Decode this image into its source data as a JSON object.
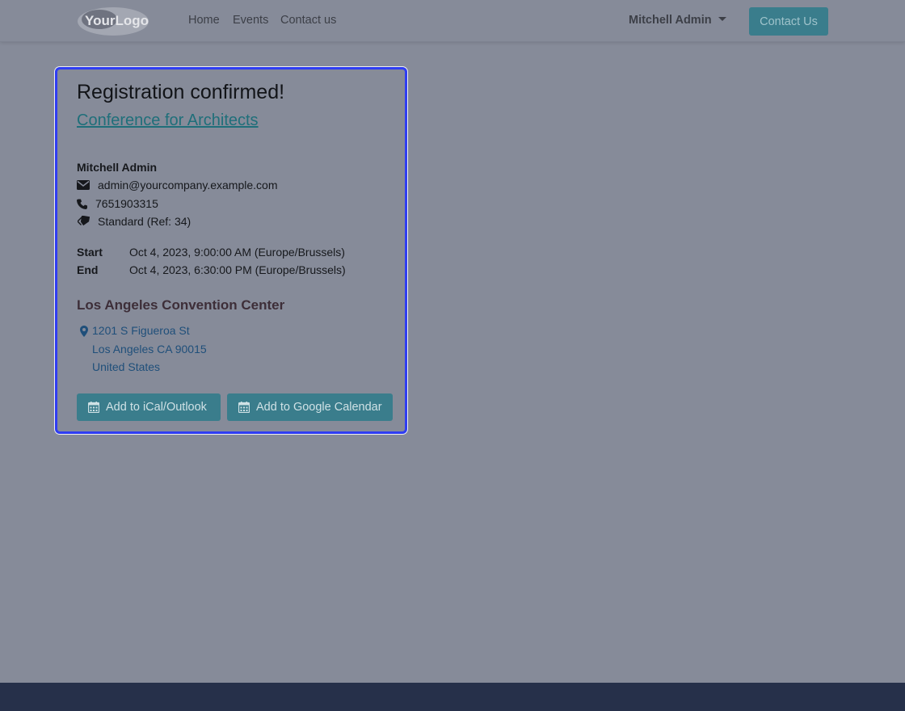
{
  "header": {
    "logo_text": "YourLogo",
    "nav": [
      "Home",
      "Events",
      "Contact us"
    ],
    "user_name": "Mitchell Admin",
    "contact_button": "Contact Us"
  },
  "confirmation": {
    "title": "Registration confirmed!",
    "event_name": "Conference for Architects",
    "attendee": {
      "name": "Mitchell Admin",
      "email": "admin@yourcompany.example.com",
      "phone": "7651903315",
      "ticket": "Standard (Ref: 34)"
    },
    "schedule": {
      "start_label": "Start",
      "start_value": "Oct 4, 2023, 9:00:00 AM (Europe/Brussels)",
      "end_label": "End",
      "end_value": "Oct 4, 2023, 6:30:00 PM (Europe/Brussels)"
    },
    "venue": {
      "name": "Los Angeles Convention Center",
      "address_line1": "1201 S Figueroa St",
      "address_line2": "Los Angeles CA 90015",
      "country": "United States"
    },
    "buttons": {
      "ical": "Add to iCal/Outlook",
      "google": "Add to Google Calendar"
    }
  },
  "icons": [
    "envelope-icon",
    "phone-icon",
    "ticket-icon",
    "map-marker-icon",
    "calendar-icon"
  ],
  "colors": {
    "primary": "#3a7d8c",
    "highlight_border": "#2f3df2",
    "footer": "#26304a"
  }
}
